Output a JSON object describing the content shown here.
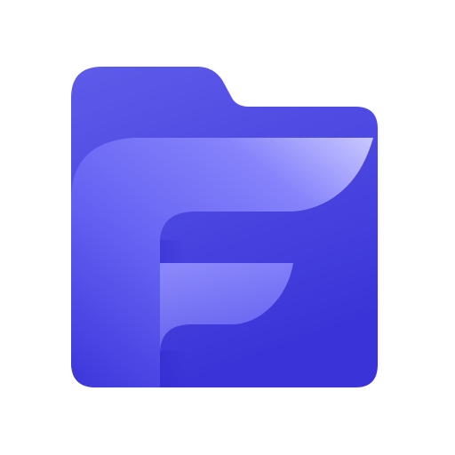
{
  "app_icon": {
    "icon": "folder-f-logo-icon",
    "colors": {
      "background": "#ffffff",
      "folder_back_light": "#5e5bea",
      "folder_back_dark": "#3a34d8",
      "folder_front_highlight": "#c9c8ff",
      "folder_front_light": "#8683fb",
      "folder_front_mid": "#6663f3",
      "folder_front_dark": "#3e38dc",
      "letter_bar_light": "#a7a5ff",
      "letter_bar_dark": "#5a56ee"
    }
  }
}
